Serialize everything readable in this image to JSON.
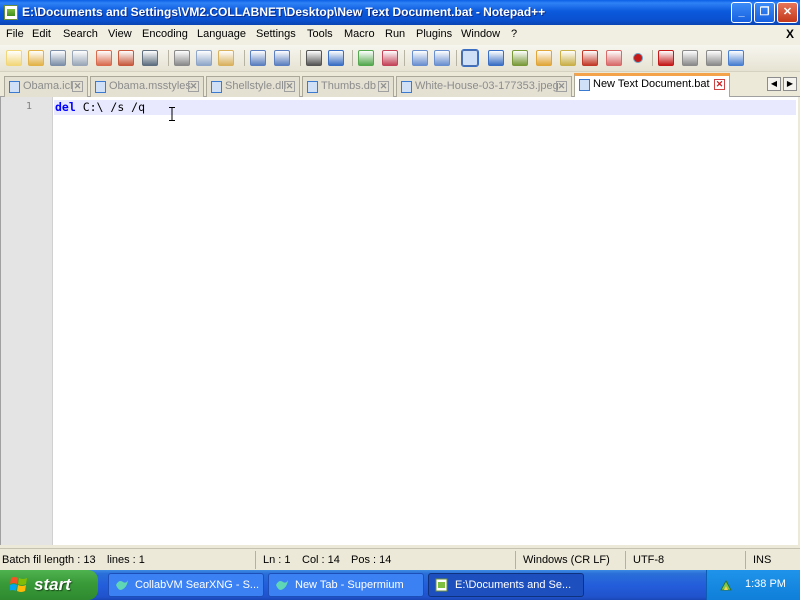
{
  "window": {
    "title": "E:\\Documents and Settings\\VM2.COLLABNET\\Desktop\\New Text Document.bat - Notepad++",
    "minimize_label": "_",
    "restore_label": "❐",
    "close_label": "✕"
  },
  "menu": {
    "items": [
      "File",
      "Edit",
      "Search",
      "View",
      "Encoding",
      "Language",
      "Settings",
      "Tools",
      "Macro",
      "Run",
      "Plugins",
      "Window",
      "?"
    ],
    "close_doc": "X"
  },
  "toolbar": {
    "icons": [
      "new-file-icon",
      "open-file-icon",
      "save-icon",
      "save-all-icon",
      "close-icon",
      "close-all-icon",
      "print-icon",
      "cut-icon",
      "copy-icon",
      "paste-icon",
      "undo-icon",
      "redo-icon",
      "find-icon",
      "replace-icon",
      "zoom-in-icon",
      "zoom-out-icon",
      "sync-vertical-icon",
      "sync-horizontal-icon",
      "word-wrap-icon",
      "show-all-chars-icon",
      "indent-guide-icon",
      "doc-map-icon",
      "function-list-icon",
      "folder-workspace-icon",
      "monitoring-icon",
      "record-macro-icon",
      "stop-macro-icon",
      "play-macro-icon",
      "run-macro-multiple-icon",
      "save-macro-icon"
    ]
  },
  "tabs": [
    {
      "label": "Obama.icl",
      "active": false
    },
    {
      "label": "Obama.msstyles",
      "active": false
    },
    {
      "label": "Shellstyle.dll",
      "active": false
    },
    {
      "label": "Thumbs.db",
      "active": false
    },
    {
      "label": "White-House-03-177353.jpeg",
      "active": false
    },
    {
      "label": "New Text Document.bat",
      "active": true
    }
  ],
  "tab_scroll": {
    "left": "◀",
    "right": "▶"
  },
  "editor": {
    "line_number": "1",
    "keyword": "del",
    "rest": " C:\\ /s /q"
  },
  "status": {
    "file_info": "Batch fil length : 13",
    "lines": "lines : 1",
    "ln": "Ln : 1",
    "col": "Col : 14",
    "pos": "Pos : 14",
    "eol": "Windows (CR LF)",
    "encoding": "UTF-8",
    "mode": "INS"
  },
  "taskbar": {
    "start_label": "start",
    "buttons": [
      {
        "label": "CollabVM SearXNG - S...",
        "active": false
      },
      {
        "label": "New Tab - Supermium",
        "active": false
      },
      {
        "label": "E:\\Documents and Se...",
        "active": true
      }
    ],
    "clock": "1:38 PM"
  }
}
